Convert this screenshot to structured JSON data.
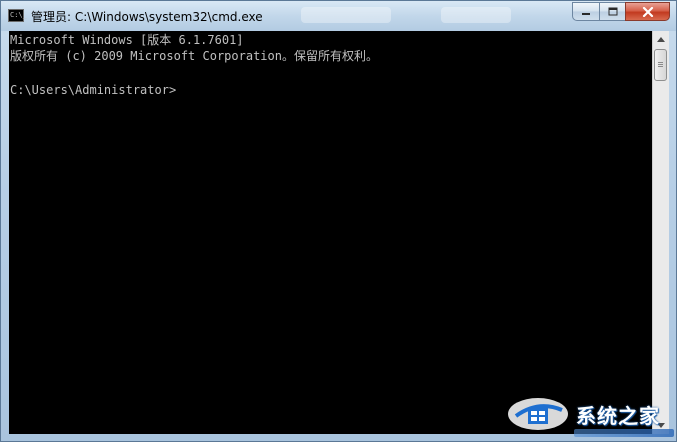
{
  "window": {
    "title": "管理员: C:\\Windows\\system32\\cmd.exe",
    "icon_text": "C:\\_"
  },
  "console": {
    "lines": [
      "Microsoft Windows [版本 6.1.7601]",
      "版权所有 (c) 2009 Microsoft Corporation。保留所有权利。",
      "",
      "C:\\Users\\Administrator>"
    ]
  },
  "watermark": {
    "text": "系统之家"
  },
  "colors": {
    "console_background": "#000000",
    "console_text": "#c0c0c0",
    "close_button": "#c23a20",
    "titlebar": "#c2d7ea"
  },
  "icons": [
    "cmd-app-icon",
    "minimize-icon",
    "maximize-icon",
    "close-icon",
    "scroll-up-icon",
    "scroll-down-icon",
    "system-home-logo-icon"
  ]
}
